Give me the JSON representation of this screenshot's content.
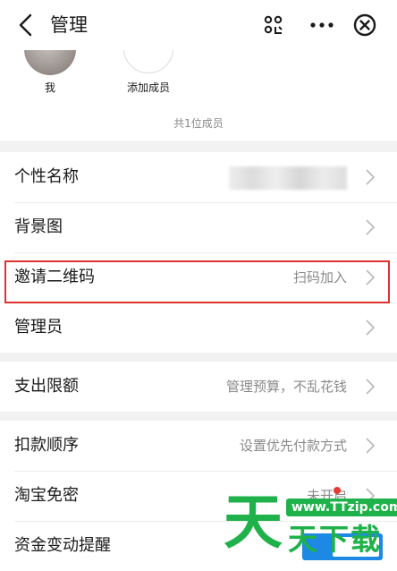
{
  "header": {
    "title": "管理",
    "back_icon": "chevron-left-icon",
    "scan_icon": "scan-icon",
    "more_icon": "more-horizontal-icon",
    "close_icon": "close-circle-icon"
  },
  "members": {
    "items": [
      {
        "label": "我"
      },
      {
        "label": "添加成员"
      }
    ],
    "count_text": "共1位成员"
  },
  "settings": {
    "group1": [
      {
        "label": "个性名称",
        "value": ""
      },
      {
        "label": "背景图",
        "value": ""
      },
      {
        "label": "邀请二维码",
        "value": "扫码加入"
      },
      {
        "label": "管理员",
        "value": ""
      }
    ],
    "group2": [
      {
        "label": "支出限额",
        "value": "管理预算，不乱花钱"
      }
    ],
    "group3": [
      {
        "label": "扣款顺序",
        "value": "设置优先付款方式"
      },
      {
        "label": "淘宝免密",
        "value": "未开启"
      },
      {
        "label": "资金变动提醒",
        "value": ""
      }
    ]
  },
  "colors": {
    "highlight": "#e0302f",
    "toggle": "#1e88e5",
    "watermark": "#1fb24a"
  },
  "watermark": {
    "url": "www.TTzip.com",
    "big": "天",
    "small": "天下载"
  }
}
